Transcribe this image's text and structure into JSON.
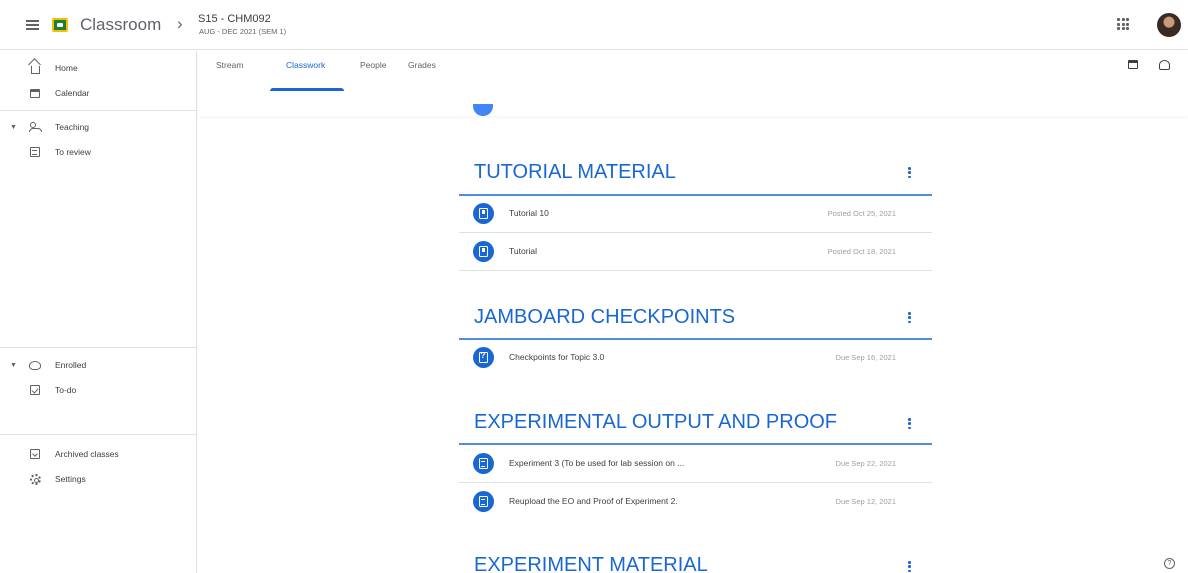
{
  "header": {
    "app_name": "Classroom",
    "breadcrumb_separator": "›",
    "class_name": "S15 - CHM092",
    "class_term": "AUG - DEC 2021 (SEM 1)"
  },
  "sidebar": {
    "home": "Home",
    "calendar": "Calendar",
    "teaching": "Teaching",
    "to_review": "To review",
    "enrolled": "Enrolled",
    "todo": "To-do",
    "archived": "Archived classes",
    "settings": "Settings"
  },
  "tabs": [
    {
      "label": "Stream"
    },
    {
      "label": "Classwork"
    },
    {
      "label": "People"
    },
    {
      "label": "Grades"
    }
  ],
  "active_tab": "Classwork",
  "colors": {
    "accent": "#1967d2",
    "icon_blue": "#4285f4",
    "muted": "#9aa0a6"
  },
  "topics": [
    {
      "title": "TUTORIAL MATERIAL",
      "items": [
        {
          "icon": "material-icon",
          "title": "Tutorial 10",
          "date": "Posted Oct 25, 2021"
        },
        {
          "icon": "material-icon",
          "title": "Tutorial",
          "date": "Posted Oct 18, 2021"
        }
      ]
    },
    {
      "title": "JAMBOARD CHECKPOINTS",
      "items": [
        {
          "icon": "question-icon",
          "title": "Checkpoints for Topic 3.0",
          "date": "Due Sep 16, 2021"
        }
      ]
    },
    {
      "title": "EXPERIMENTAL OUTPUT AND PROOF",
      "items": [
        {
          "icon": "assignment-icon",
          "title": "Experiment 3 (To be used for lab session on ...",
          "date": "Due Sep 22, 2021"
        },
        {
          "icon": "assignment-icon",
          "title": "Reupload the EO and Proof of Experiment 2.",
          "date": "Due Sep 12, 2021"
        }
      ]
    },
    {
      "title": "EXPERIMENT MATERIAL",
      "items": []
    }
  ],
  "help": "?"
}
